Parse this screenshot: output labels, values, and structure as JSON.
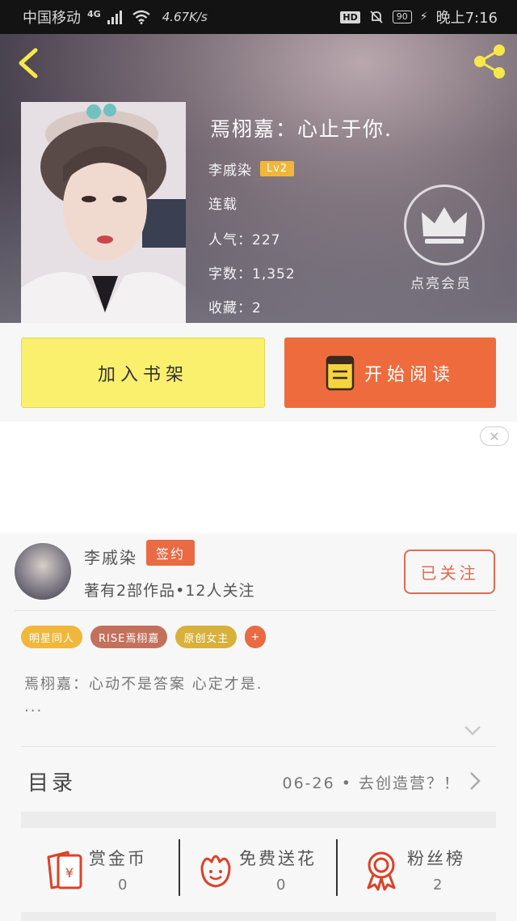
{
  "status_bar": {
    "carrier": "中国移动",
    "network": "4G",
    "speed": "4.67K/s",
    "hd": "HD",
    "battery": "90",
    "time": "晚上7:16"
  },
  "book": {
    "title": "焉栩嘉：心止于你.",
    "author": "李戚染",
    "level": "Lv2",
    "status": "连载",
    "popularity": "人气：227",
    "word_count": "字数：1,352",
    "favorites": "收藏：2"
  },
  "vip": {
    "label": "点亮会员"
  },
  "actions": {
    "add_shelf": "加入书架",
    "start_read": "开始阅读"
  },
  "ad": {
    "close": "✕"
  },
  "author_card": {
    "name": "李戚染",
    "badge": "签约",
    "stats": "著有2部作品•12人关注",
    "follow": "已关注"
  },
  "tags": [
    "明星同人",
    "RISE焉栩嘉",
    "原创女主",
    "+"
  ],
  "description": {
    "line1": "焉栩嘉：心动不是答案 心定才是.",
    "line2": "..."
  },
  "catalog": {
    "title": "目录",
    "latest": "06-26 • 去创造营？！"
  },
  "bottom_stats": [
    {
      "label": "赏金币",
      "value": "0"
    },
    {
      "label": "免费送花",
      "value": "0"
    },
    {
      "label": "粉丝榜",
      "value": "2"
    }
  ],
  "colors": {
    "accent": "#ee6b3e",
    "shelf_yellow": "#fbf06e",
    "level_badge": "#f0b73a",
    "icon_red": "#d9432a"
  }
}
